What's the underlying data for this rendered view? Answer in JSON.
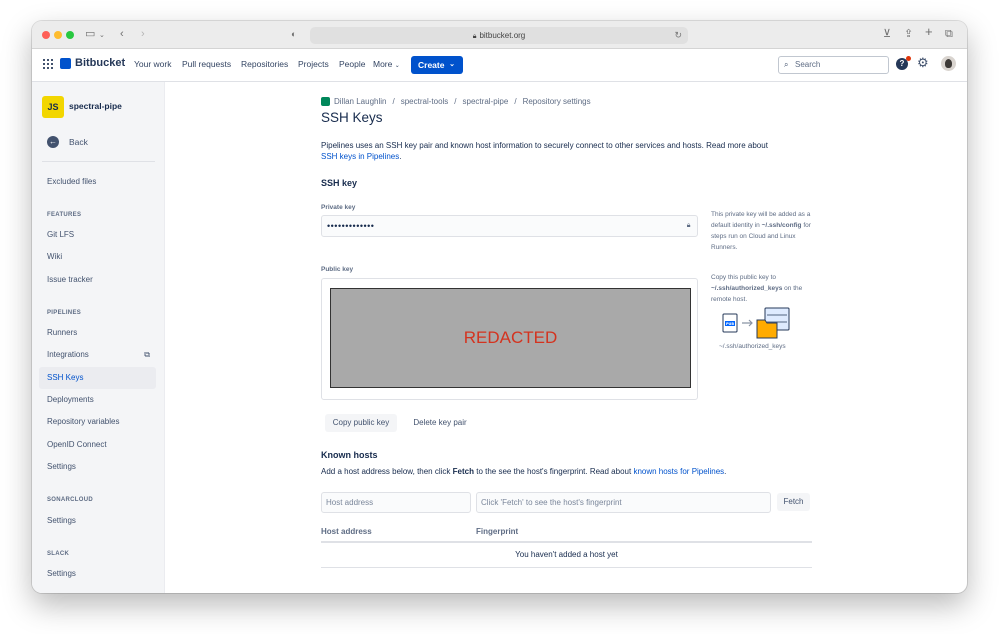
{
  "browser": {
    "url": "bitbucket.org"
  },
  "nav": {
    "brand": "Bitbucket",
    "links": [
      "Your work",
      "Pull requests",
      "Repositories",
      "Projects",
      "People",
      "More"
    ],
    "create_label": "Create",
    "search_placeholder": "Search",
    "help_label": "?"
  },
  "sidebar": {
    "repo_initials": "JS",
    "repo_name": "spectral-pipe",
    "back_label": "Back",
    "excluded_files": "Excluded files",
    "sections": {
      "features": "FEATURES",
      "pipelines": "PIPELINES",
      "sonarcloud": "SONARCLOUD",
      "slack": "SLACK"
    },
    "features_items": [
      "Git LFS",
      "Wiki",
      "Issue tracker"
    ],
    "pipelines_items": [
      "Runners",
      "Integrations",
      "SSH Keys",
      "Deployments",
      "Repository variables",
      "OpenID Connect",
      "Settings"
    ],
    "sonarcloud_items": [
      "Settings"
    ],
    "slack_items": [
      "Settings"
    ],
    "active_item": "SSH Keys"
  },
  "breadcrumb": [
    "Dillan Laughlin",
    "spectral-tools",
    "spectral-pipe",
    "Repository settings"
  ],
  "page": {
    "title": "SSH Keys",
    "description": "Pipelines uses an SSH key pair and known host information to securely connect to other services and hosts. Read more about",
    "description_link": "SSH keys in Pipelines",
    "description_end": "."
  },
  "ssh_key": {
    "heading": "SSH key",
    "private_label": "Private key",
    "private_value": "•••••••••••••",
    "private_hint_1": "This private key will be added as a default identity in",
    "private_hint_path": "~/.ssh/config",
    "private_hint_2": "for steps run on Cloud and Linux Runners.",
    "public_label": "Public key",
    "public_value": "REDACTED",
    "public_hint_1": "Copy this public key to",
    "public_hint_path": "~/.ssh/authorized_keys",
    "public_hint_2": "on the remote host.",
    "illustration_caption": "~/.ssh/authorized_keys",
    "illustration_file": "PUB",
    "copy_button": "Copy public key",
    "delete_button": "Delete key pair"
  },
  "known_hosts": {
    "heading": "Known hosts",
    "desc_1": "Add a host address below, then click",
    "desc_bold": "Fetch",
    "desc_2": "to the see the host's fingerprint. Read about",
    "desc_link": "known hosts for Pipelines",
    "desc_end": ".",
    "host_placeholder": "Host address",
    "fingerprint_placeholder": "Click 'Fetch' to see the host's fingerprint",
    "fetch_button": "Fetch",
    "col_host": "Host address",
    "col_fingerprint": "Fingerprint",
    "empty_message": "You haven't added a host yet"
  },
  "colors": {
    "primary": "#0052cc",
    "repo_avatar": "#f2d600",
    "redacted_text": "#d4331f",
    "redacted_bg": "#a9a9a9"
  }
}
